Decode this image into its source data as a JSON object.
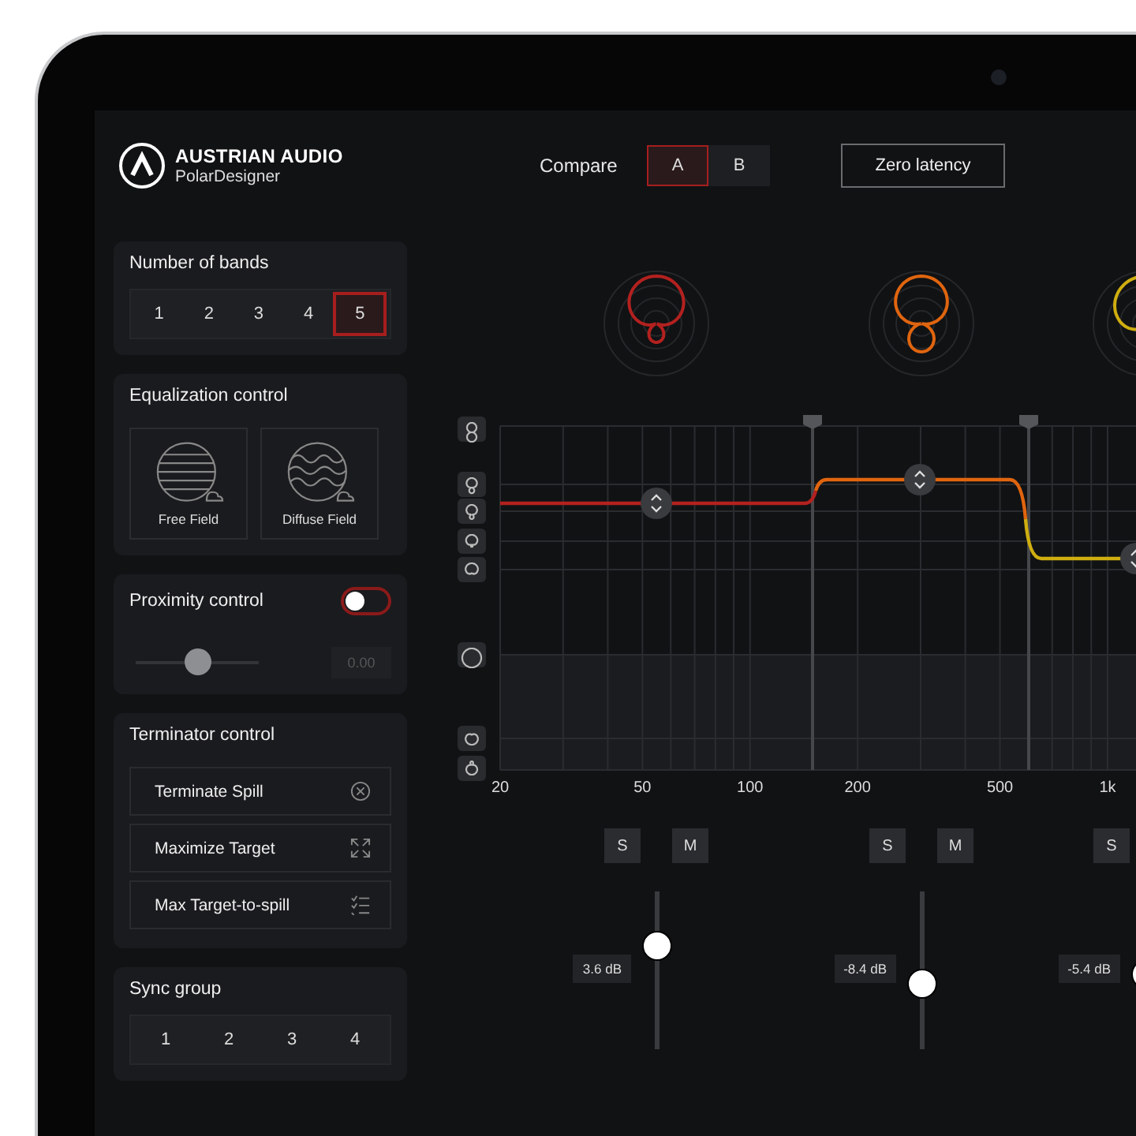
{
  "brand": {
    "name": "AUSTRIAN AUDIO",
    "product": "PolarDesigner"
  },
  "compare": {
    "label": "Compare",
    "options": [
      {
        "label": "A",
        "selected": true
      },
      {
        "label": "B",
        "selected": false
      }
    ]
  },
  "zero_latency": {
    "label": "Zero latency"
  },
  "number_of_bands": {
    "title": "Number of bands",
    "options": [
      {
        "label": "1",
        "selected": false
      },
      {
        "label": "2",
        "selected": false
      },
      {
        "label": "3",
        "selected": false
      },
      {
        "label": "4",
        "selected": false
      },
      {
        "label": "5",
        "selected": true
      }
    ]
  },
  "equalization": {
    "title": "Equalization control",
    "options": [
      {
        "label": "Free Field",
        "kind": "stripes",
        "selected": false
      },
      {
        "label": "Diffuse Field",
        "kind": "waves",
        "selected": false
      }
    ]
  },
  "proximity": {
    "title": "Proximity control",
    "on": false,
    "level": 0.5,
    "value": "0.00",
    "disabled": true
  },
  "terminator": {
    "title": "Terminator control",
    "actions": [
      {
        "label": "Terminate Spill",
        "kind": "cancel"
      },
      {
        "label": "Maximize Target",
        "kind": "expand"
      },
      {
        "label": "Max Target-to-spill",
        "kind": "list"
      }
    ]
  },
  "sync_group": {
    "title": "Sync group",
    "options": [
      {
        "label": "1",
        "selected": false
      },
      {
        "label": "2",
        "selected": false
      },
      {
        "label": "3",
        "selected": false
      },
      {
        "label": "4",
        "selected": false
      }
    ]
  },
  "graph": {
    "freq_labels": [
      "20",
      "50",
      "100",
      "200",
      "500",
      "1k"
    ]
  },
  "bands": [
    {
      "color": "#b3211f",
      "solo": "S",
      "mute": "M",
      "level": 0.68,
      "reading": "3.6 dB"
    },
    {
      "color": "#e0650f",
      "solo": "S",
      "mute": "M",
      "level": 0.39,
      "reading": "-8.4 dB"
    },
    {
      "color": "#cfae10",
      "solo": "S",
      "level": 0.46,
      "reading": "-5.4 dB"
    }
  ]
}
